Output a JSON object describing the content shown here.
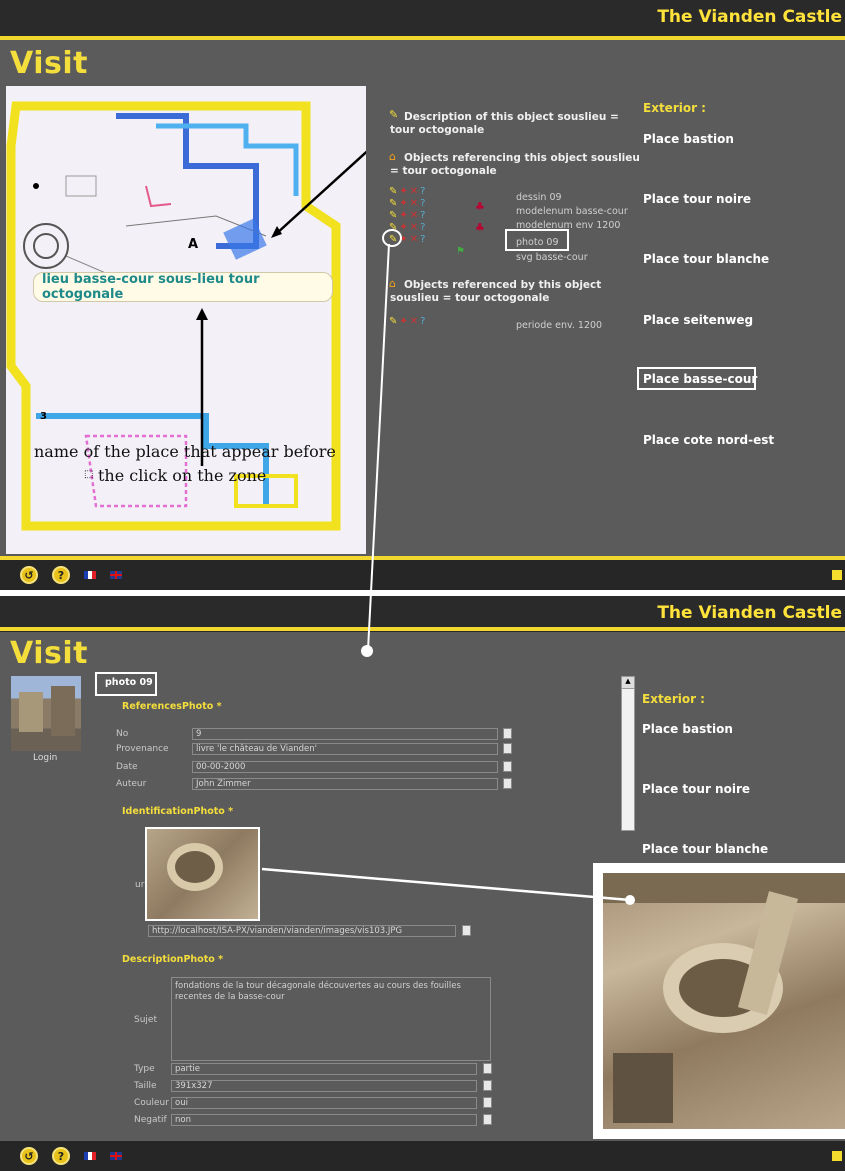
{
  "brand": "The Vianden Castle",
  "visit": "Visit",
  "map_label": "lieu basse-cour sous-lieu tour octogonale",
  "map_letter_a": "A",
  "map_number": "3",
  "caption_line1": "name of the place that appear before",
  "caption_line2": "the click on the zone",
  "desc_label": "Description of this object souslieu = tour octogonale",
  "refing_label": "Objects referencing this object souslieu = tour octogonale",
  "refed_label": "Objects referenced by this object souslieu = tour octogonale",
  "ref_items": [
    "dessin 09",
    "modelenum basse-cour",
    "modelenum env 1200",
    "photo 09",
    "svg basse-cour"
  ],
  "refed_items": [
    "periode env. 1200"
  ],
  "exterior": "Exterior :",
  "places_top": [
    "Place bastion",
    "Place tour noire",
    "Place tour blanche",
    "Place seitenweg",
    "Place basse-cour",
    "Place cote nord-est"
  ],
  "places_bottom": [
    "Place bastion",
    "Place tour noire",
    "Place tour blanche"
  ],
  "login": "Login",
  "photo_title": "photo 09",
  "sec_refs": "ReferencesPhoto *",
  "sec_ident": "IdentificationPhoto *",
  "sec_desc": "DescriptionPhoto *",
  "ref_fields": [
    {
      "label": "No",
      "value": "9"
    },
    {
      "label": "Provenance",
      "value": "livre 'le château de Vianden'"
    },
    {
      "label": "Date",
      "value": "00-00-2000"
    },
    {
      "label": "Auteur",
      "value": "John Zimmer"
    }
  ],
  "url_label": "ur",
  "url_value": "http://localhost/ISA-PX/vianden/vianden/images/vis103.JPG",
  "sujet_label": "Sujet",
  "sujet_value": "fondations de la tour décagonale découvertes au cours des fouilles recentes de la basse-cour",
  "desc_fields": [
    {
      "label": "Type",
      "value": "partie"
    },
    {
      "label": "Taille",
      "value": "391x327"
    },
    {
      "label": "Couleur",
      "value": "oui"
    },
    {
      "label": "Negatif",
      "value": "non"
    }
  ],
  "colors": {
    "accent": "#f4de3c",
    "panel": "#5b5b5b",
    "bar": "#262626"
  }
}
